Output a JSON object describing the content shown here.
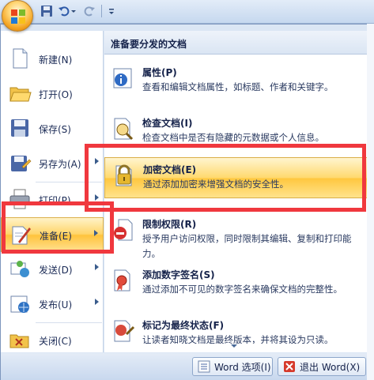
{
  "quick_access": {
    "icons": [
      "save-icon",
      "undo-icon",
      "redo-icon",
      "customize-qat-icon"
    ]
  },
  "office_menu": {
    "left_items": [
      {
        "label": "新建(N)",
        "icon": "new-document-icon",
        "has_submenu": false
      },
      {
        "label": "打开(O)",
        "icon": "open-folder-icon",
        "has_submenu": false
      },
      {
        "label": "保存(S)",
        "icon": "save-icon",
        "has_submenu": false
      },
      {
        "label": "另存为(A)",
        "icon": "save-as-icon",
        "has_submenu": true
      },
      {
        "label": "打印(P)",
        "icon": "print-icon",
        "has_submenu": true
      },
      {
        "label": "准备(E)",
        "icon": "prepare-icon",
        "has_submenu": true,
        "highlighted": true
      },
      {
        "label": "发送(D)",
        "icon": "send-icon",
        "has_submenu": true
      },
      {
        "label": "发布(U)",
        "icon": "publish-icon",
        "has_submenu": true
      },
      {
        "label": "关闭(C)",
        "icon": "close-folder-icon",
        "has_submenu": false
      }
    ],
    "submenu": {
      "header": "准备要分发的文档",
      "items": [
        {
          "title": "属性(P)",
          "desc": "查看和编辑文档属性，如标题、作者和关键字。",
          "icon": "properties-icon"
        },
        {
          "title": "检查文档(I)",
          "desc": "检查文档中是否有隐藏的元数据或个人信息。",
          "icon": "inspect-document-icon"
        },
        {
          "title": "加密文档(E)",
          "desc": "通过添加加密来增强文档的安全性。",
          "icon": "lock-icon",
          "highlighted": true
        },
        {
          "title": "限制权限(R)",
          "desc": "授予用户访问权限，同时限制其编辑、复制和打印能力。",
          "icon": "restrict-permission-icon"
        },
        {
          "title": "添加数字签名(S)",
          "desc": "通过添加不可见的数字签名来确保文档的完整性。",
          "icon": "digital-signature-icon"
        },
        {
          "title": "标记为最终状态(F)",
          "desc": "让读者知晓文档是最终版本，并将其设为只读。",
          "icon": "mark-final-icon"
        }
      ]
    },
    "bottom_buttons": {
      "options_label": "Word 选项(I)",
      "exit_label": "退出 Word(X)"
    }
  },
  "colors": {
    "annotation_red": "#f0383e",
    "hover_gold": "#ffc33c",
    "menu_blue": "#dbe6f4"
  }
}
